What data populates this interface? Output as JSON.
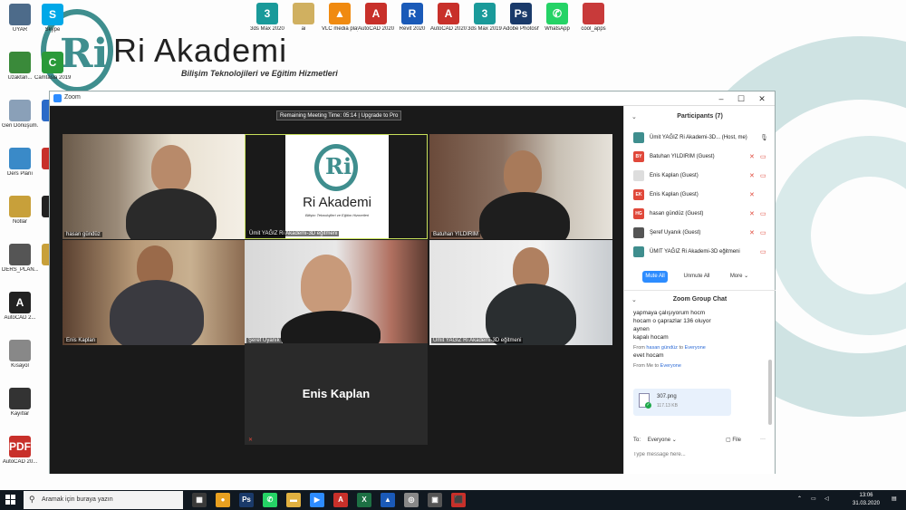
{
  "brand": {
    "name": "Ri Akademi",
    "subtitle": "Bilişim Teknolojileri ve Eğitim Hizmetleri",
    "logo_letter": "Ri"
  },
  "desktop_icons_left": [
    {
      "label": "UYAR",
      "color": "#4d6b8a",
      "glyph": ""
    },
    {
      "label": "Uzaktan...",
      "color": "#3a8a3a",
      "glyph": ""
    },
    {
      "label": "Geri Dönüşüm...",
      "color": "#8aa0b8",
      "glyph": ""
    },
    {
      "label": "Ders Planı",
      "color": "#3a8ac8",
      "glyph": ""
    },
    {
      "label": "Notlar",
      "color": "#c8a03a",
      "glyph": ""
    },
    {
      "label": "DERS_PLAN...",
      "color": "#555555",
      "glyph": ""
    },
    {
      "label": "AutoCAD 2...",
      "color": "#222222",
      "glyph": "A"
    },
    {
      "label": "Kısayol",
      "color": "#888888",
      "glyph": ""
    },
    {
      "label": "Kayıtlar",
      "color": "#333333",
      "glyph": ""
    },
    {
      "label": "AutoCAD 20...",
      "color": "#c8302a",
      "glyph": "PDF"
    }
  ],
  "desktop_icons_col2": [
    {
      "label": "Skype",
      "color": "#00a8e8",
      "glyph": "S"
    },
    {
      "label": "Camtasia 2019",
      "color": "#2a9a3a",
      "glyph": "C"
    },
    {
      "label": "",
      "color": "#2a6ac8",
      "glyph": ""
    },
    {
      "label": "",
      "color": "#c8302a",
      "glyph": ""
    },
    {
      "label": "",
      "color": "#222222",
      "glyph": ""
    },
    {
      "label": "",
      "color": "#c8a03a",
      "glyph": ""
    }
  ],
  "desktop_icons_top": [
    {
      "label": "3ds Max 2020",
      "color": "#1a9a9a",
      "glyph": "3"
    },
    {
      "label": "ai",
      "color": "#d0b060",
      "glyph": ""
    },
    {
      "label": "VLC media player",
      "color": "#f08a10",
      "glyph": "▲"
    },
    {
      "label": "AutoCAD 2020 - Türkçe",
      "color": "#c8302a",
      "glyph": "A"
    },
    {
      "label": "Revit 2020",
      "color": "#1a5ab8",
      "glyph": "R"
    },
    {
      "label": "AutoCAD 2020",
      "color": "#c8302a",
      "glyph": "A"
    },
    {
      "label": "3ds Max 2019",
      "color": "#1a9a9a",
      "glyph": "3"
    },
    {
      "label": "Adobe Photosh...",
      "color": "#1a3a6a",
      "glyph": "Ps"
    },
    {
      "label": "WhatsApp",
      "color": "#25d366",
      "glyph": "✆"
    },
    {
      "label": "cool_apps",
      "color": "#c83a3a",
      "glyph": ""
    }
  ],
  "zoom": {
    "title": "Zoom",
    "timer": "Remaining Meeting Time: 05:14 | Upgrade to Pro",
    "tiles": [
      {
        "name": "hasan gündüz"
      },
      {
        "name": "Ümit YAĞIZ Ri Akademi-3D eğitmeni"
      },
      {
        "name": "Batuhan YILDIRIM"
      },
      {
        "name": "Enis Kaplan"
      },
      {
        "name": "Şeref Uyanık"
      },
      {
        "name": "Ümit YAĞIZ Ri Akademi-3D eğitmeni"
      },
      {
        "name": "Enis Kaplan"
      }
    ],
    "participants_title": "Participants (7)",
    "participants": [
      {
        "initials": "",
        "name": "Ümit YAĞIZ Ri Akademi-3D... (Host, me)",
        "color": "#3f8e8e"
      },
      {
        "initials": "BY",
        "name": "Batuhan YILDIRIM (Guest)",
        "color": "#e0483a"
      },
      {
        "initials": "",
        "name": "Enis Kaplan (Guest)",
        "color": "#dddddd"
      },
      {
        "initials": "EK",
        "name": "Enis Kaplan (Guest)",
        "color": "#e0483a"
      },
      {
        "initials": "HG",
        "name": "hasan gündüz (Guest)",
        "color": "#e0483a"
      },
      {
        "initials": "",
        "name": "Şeref Uyanık (Guest)",
        "color": "#555555"
      },
      {
        "initials": "",
        "name": "ÜMIT YAĞIZ Ri Akademi-3D eğitmeni",
        "color": "#3f8e8e"
      }
    ],
    "buttons": {
      "mute_all": "Mute All",
      "unmute_all": "Unmute All",
      "more": "More"
    },
    "chat_title": "Zoom Group Chat",
    "chat_lines": [
      "yapmaya çalışıyorum hocm",
      "hocam o çaprazlar 136 oluyor",
      "aynen",
      "kapalı hocam"
    ],
    "chat_from1_prefix": "From",
    "chat_from1_sender": "hasan gündüz",
    "chat_from1_to": "to",
    "chat_from1_target": "Everyone",
    "chat_msg2": "evet hocam",
    "chat_from2_prefix": "From Me to",
    "chat_from2_target": "Everyone",
    "file": {
      "name": "307.png",
      "size": "117.13 KB"
    },
    "to_label": "To:",
    "to_value": "Everyone",
    "file_btn": "File",
    "input_placeholder": "Type message here..."
  },
  "taskbar": {
    "search_placeholder": "Aramak için buraya yazın",
    "apps": [
      {
        "color": "#3a3a3a",
        "glyph": "▦"
      },
      {
        "color": "#e8a020",
        "glyph": "●"
      },
      {
        "color": "#1a3a6a",
        "glyph": "Ps"
      },
      {
        "color": "#25d366",
        "glyph": "✆"
      },
      {
        "color": "#e0b040",
        "glyph": "▬"
      },
      {
        "color": "#2d8cff",
        "glyph": "▶"
      },
      {
        "color": "#c8302a",
        "glyph": "A"
      },
      {
        "color": "#1d7044",
        "glyph": "X"
      },
      {
        "color": "#1a5ab8",
        "glyph": "▲"
      },
      {
        "color": "#888888",
        "glyph": "◎"
      },
      {
        "color": "#555555",
        "glyph": "▣"
      },
      {
        "color": "#c8302a",
        "glyph": "⬛"
      }
    ],
    "time": "13:06",
    "date": "31.03.2020"
  }
}
